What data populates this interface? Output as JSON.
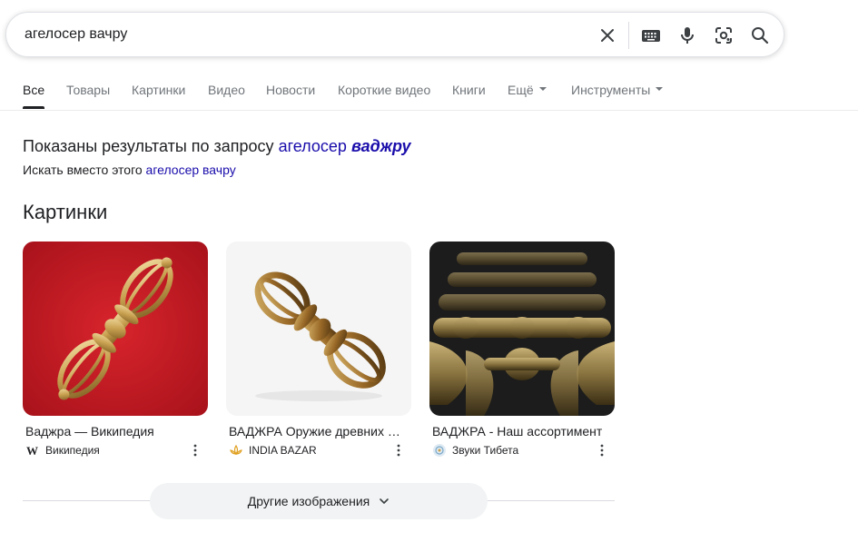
{
  "search": {
    "query": "агелосер вачру"
  },
  "tabs": [
    {
      "label": "Все"
    },
    {
      "label": "Товары"
    },
    {
      "label": "Картинки"
    },
    {
      "label": "Видео"
    },
    {
      "label": "Новости"
    },
    {
      "label": "Короткие видео"
    },
    {
      "label": "Книги"
    },
    {
      "label": "Ещё"
    },
    {
      "label": "Инструменты"
    }
  ],
  "spelling": {
    "showing_prefix": "Показаны результаты по запросу",
    "corrected_plain": "агелосер",
    "corrected_bold": "ваджру",
    "instead_prefix": "Искать вместо этого",
    "original_query": "агелосер вачру"
  },
  "images_section": {
    "title": "Картинки",
    "cards": [
      {
        "title": "Ваджра — Википедия",
        "source": "Википедия",
        "favicon": "wikipedia-w-icon"
      },
      {
        "title": "ВАДЖРА Оружие древних Богов",
        "source": "INDIA BAZAR",
        "favicon": "india-bazar-lotus-icon"
      },
      {
        "title": "ВАДЖРА - Наш ассортимент",
        "source": "Звуки Тибета",
        "favicon": "zvuki-tibeta-icon"
      }
    ],
    "more_label": "Другие изображения"
  },
  "colors": {
    "link": "#1a0dab",
    "text": "#202124",
    "muted": "#70757a"
  }
}
